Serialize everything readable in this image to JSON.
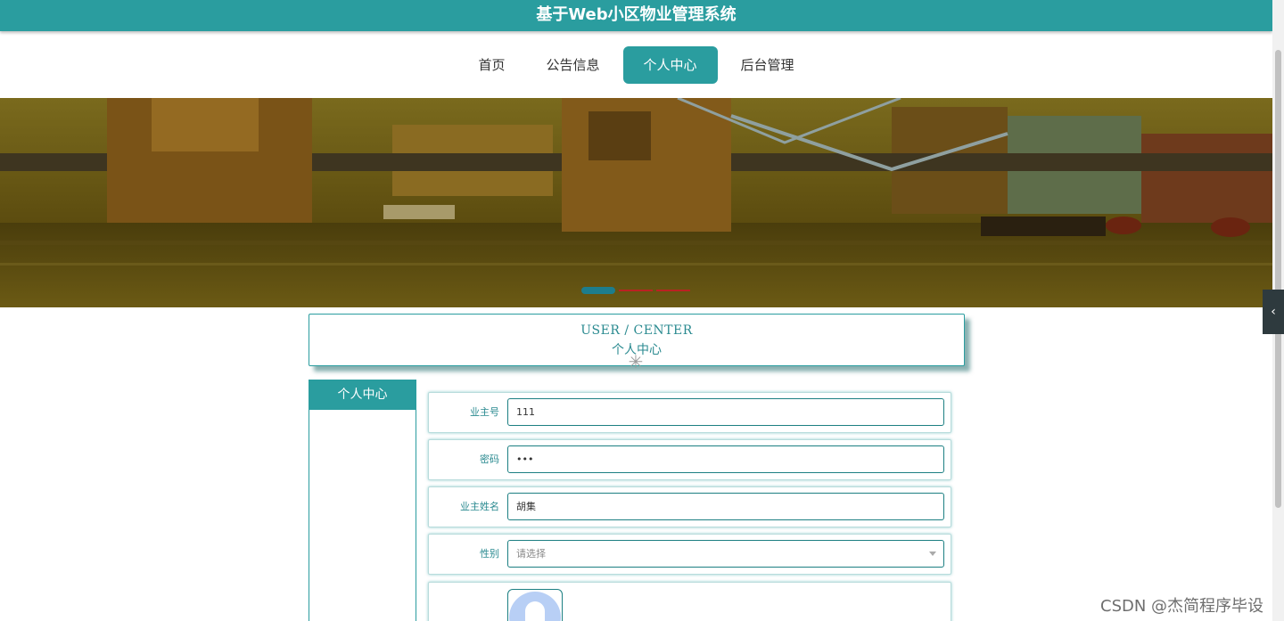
{
  "header": {
    "title": "基于Web小区物业管理系统"
  },
  "nav": {
    "items": [
      {
        "label": "首页",
        "active": false
      },
      {
        "label": "公告信息",
        "active": false
      },
      {
        "label": "个人中心",
        "active": true
      },
      {
        "label": "后台管理",
        "active": false
      }
    ]
  },
  "banner": {
    "carousel_slide_count": 3,
    "carousel_active_index": 0
  },
  "center_heading": {
    "en": "USER / CENTER",
    "cn": "个人中心"
  },
  "sidebar": {
    "title": "个人中心"
  },
  "form": {
    "owner_id": {
      "label": "业主号",
      "value": "111"
    },
    "password": {
      "label": "密码",
      "value": "•••"
    },
    "owner_name": {
      "label": "业主姓名",
      "value": "胡集"
    },
    "gender": {
      "label": "性别",
      "placeholder": "请选择"
    }
  },
  "watermark": "CSDN @杰简程序毕设",
  "colors": {
    "accent": "#2a9d9f",
    "accent_dark": "#1c7f82"
  },
  "icons": {
    "side_toggle": "chevron-left-icon",
    "loader": "loading-spinner-icon",
    "avatar": "user-avatar-icon"
  }
}
